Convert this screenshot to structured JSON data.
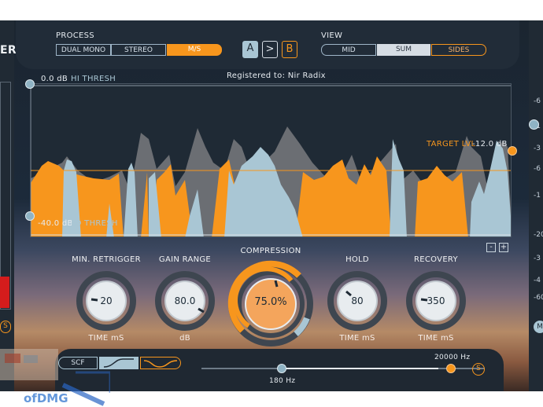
{
  "title_fragment": "ER",
  "process": {
    "label": "PROCESS",
    "options": [
      "DUAL MONO",
      "STEREO",
      "M/S"
    ],
    "selected": "M/S"
  },
  "ab": {
    "a": "A",
    "copy": ">",
    "b": "B"
  },
  "view": {
    "label": "VIEW",
    "options": [
      "MID",
      "SUM",
      "SIDES"
    ],
    "selected": "SUM"
  },
  "graph": {
    "registered": "Registered to: Nir Radix",
    "hi_thresh_value": "0.0 dB",
    "hi_thresh_label": "HI THRESH",
    "lo_thresh_value": "-40.0 dB",
    "lo_thresh_label": "LO THRESH",
    "target_label": "TARGET LVL",
    "target_value": "-12.0 dB",
    "zoom_out": "-",
    "zoom_in": "+"
  },
  "knobs": [
    {
      "label": "MIN. RETRIGGER",
      "value": "20",
      "unit": "TIME mS",
      "fraction": 0.2
    },
    {
      "label": "GAIN RANGE",
      "value": "80.0",
      "unit": "dB",
      "fraction": 0.85
    },
    {
      "label": "COMPRESSION",
      "value": "75.0%",
      "unit": "",
      "fraction": 0.75
    },
    {
      "label": "HOLD",
      "value": "80",
      "unit": "TIME mS",
      "fraction": 0.3
    },
    {
      "label": "RECOVERY",
      "value": "350",
      "unit": "TIME mS",
      "fraction": 0.2
    }
  ],
  "sidechain": {
    "mode_label": "SCF",
    "low_freq": "180 Hz",
    "high_freq": "20000 Hz",
    "low_fraction": 0.3,
    "high_fraction": 0.95,
    "solo_label": "S"
  },
  "left_solo_label": "S",
  "right_meter_scale": [
    "-6",
    "-1",
    "-3",
    "-6",
    "-1",
    "-20",
    "-3",
    "-4",
    "-60"
  ],
  "right_button_label": "M",
  "watermark": "ofDMG",
  "colors": {
    "orange": "#f7961d",
    "blue": "#a9c6d4",
    "panel": "#212c38"
  }
}
